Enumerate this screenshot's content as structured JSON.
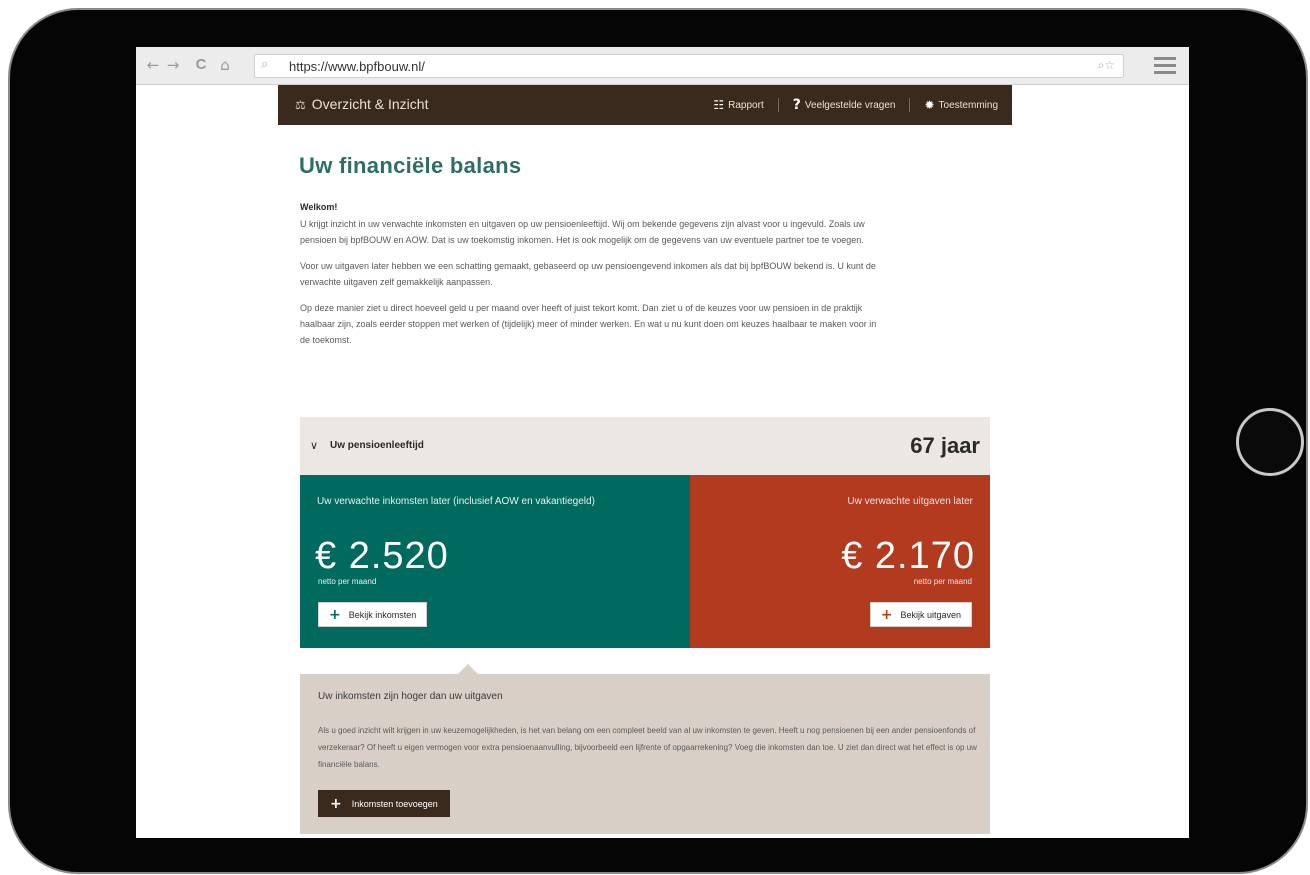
{
  "browser": {
    "url": "https://www.bpfbouw.nl/",
    "back_icon": "←",
    "forward_icon": "→",
    "reload_icon": "C",
    "home_icon": "⌂",
    "search_icon": "⌕",
    "tools_icon": "⌕☆"
  },
  "header": {
    "logo_icon": "⚖",
    "logo_text": "Overzicht & Inzicht",
    "nav": [
      {
        "icon": "☷",
        "label": "Rapport"
      },
      {
        "icon": "?",
        "label": "Veelgestelde vragen"
      },
      {
        "icon": "✹",
        "label": "Toestemming"
      }
    ]
  },
  "main": {
    "title": "Uw financiële balans",
    "welcome": "Welkom!",
    "paragraphs": [
      "U krijgt inzicht in uw verwachte inkomsten en uitgaven op uw pensioenleeftijd. Wij om bekende gegevens zijn alvast voor u ingevuld. Zoals uw pensioen bij bpfBOUW en AOW. Dat is uw toekomstig inkomen. Het is ook mogelijk om de gegevens van uw eventuele partner toe te voegen.",
      "Voor uw uitgaven later hebben we een schatting gemaakt, gebaseerd op uw pensioengevend inkomen als dat bij bpfBOUW bekend is. U kunt de verwachte uitgaven zelf gemakkelijk aanpassen.",
      "Op deze manier ziet u direct hoeveel geld u per maand over heeft of juist tekort komt. Dan ziet u of de keuzes voor uw pensioen in de praktijk haalbaar zijn, zoals eerder stoppen met werken of (tijdelijk) meer of minder werken. En wat u nu kunt doen om keuzes haalbaar te maken voor in de toekomst."
    ]
  },
  "pension": {
    "chevron": "∨",
    "label": "Uw pensioenleeftijd",
    "age": "67 jaar"
  },
  "income": {
    "title": "Uw verwachte inkomsten later (inclusief AOW en vakantiegeld)",
    "amount": "€ 2.520",
    "unit": "netto per maand",
    "button": "Bekijk inkomsten",
    "color": "#006a5e"
  },
  "expense": {
    "title": "Uw verwachte uitgaven later",
    "amount": "€ 2.170",
    "unit": "netto per maand",
    "button": "Bekijk uitgaven",
    "color": "#b23a1e"
  },
  "result": {
    "heading": "Uw inkomsten zijn hoger dan uw uitgaven",
    "body": "Als u goed inzicht wilt krijgen in uw keuzemogelijkheden, is het van belang om een compleet beeld van al uw inkomsten te geven. Heeft u nog pensioenen bij een ander pensioenfonds of verzekeraar? Of heeft u eigen vermogen voor extra pensioenaanvulling, bijvoorbeeld een lijfrente of opgaarrekening? Voeg die inkomsten dan toe. U ziet dan direct wat het effect is op uw financiële balans.",
    "button": "Inkomsten toevoegen"
  },
  "plus_icon": "+"
}
